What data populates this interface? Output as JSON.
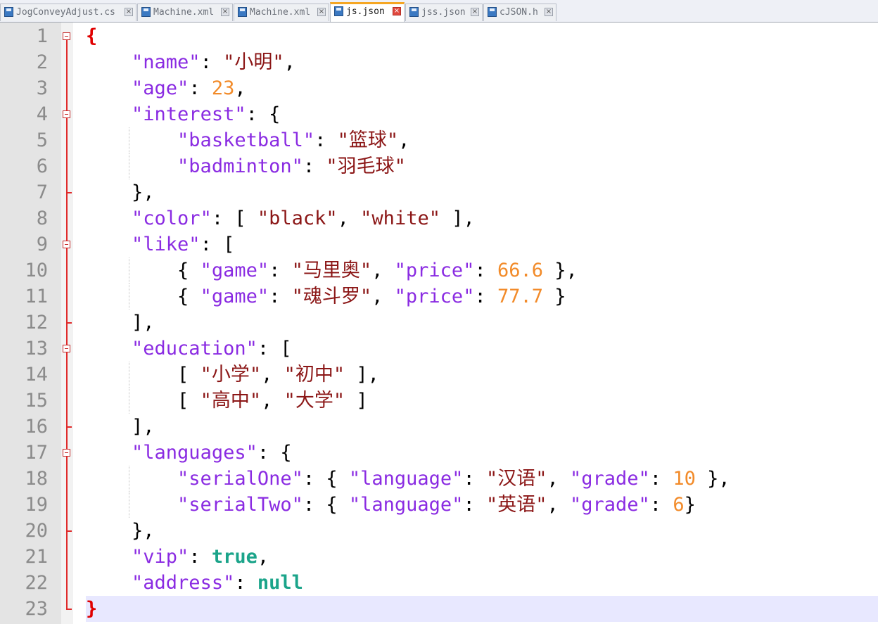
{
  "tabs": [
    {
      "label": "JogConveyAdjust.cs",
      "active": false
    },
    {
      "label": "Machine.xml",
      "active": false
    },
    {
      "label": "Machine.xml",
      "active": false
    },
    {
      "label": "js.json",
      "active": true
    },
    {
      "label": "jss.json",
      "active": false
    },
    {
      "label": "cJSON.h",
      "active": false
    }
  ],
  "editor": {
    "current_line": 23,
    "lines": [
      {
        "n": "1",
        "tokens": [
          {
            "t": "{",
            "c": "br"
          }
        ],
        "fold": "box"
      },
      {
        "n": "2",
        "tokens": [
          {
            "t": "    ",
            "c": "p"
          },
          {
            "t": "\"name\"",
            "c": "k"
          },
          {
            "t": ": ",
            "c": "p"
          },
          {
            "t": "\"小明\"",
            "c": "s"
          },
          {
            "t": ",",
            "c": "p"
          }
        ]
      },
      {
        "n": "3",
        "tokens": [
          {
            "t": "    ",
            "c": "p"
          },
          {
            "t": "\"age\"",
            "c": "k"
          },
          {
            "t": ": ",
            "c": "p"
          },
          {
            "t": "23",
            "c": "n"
          },
          {
            "t": ",",
            "c": "p"
          }
        ]
      },
      {
        "n": "4",
        "tokens": [
          {
            "t": "    ",
            "c": "p"
          },
          {
            "t": "\"interest\"",
            "c": "k"
          },
          {
            "t": ": {",
            "c": "p"
          }
        ],
        "fold": "box"
      },
      {
        "n": "5",
        "tokens": [
          {
            "t": "        ",
            "c": "p"
          },
          {
            "t": "\"basketball\"",
            "c": "k"
          },
          {
            "t": ": ",
            "c": "p"
          },
          {
            "t": "\"篮球\"",
            "c": "s"
          },
          {
            "t": ",",
            "c": "p"
          }
        ],
        "guide": true
      },
      {
        "n": "6",
        "tokens": [
          {
            "t": "        ",
            "c": "p"
          },
          {
            "t": "\"badminton\"",
            "c": "k"
          },
          {
            "t": ": ",
            "c": "p"
          },
          {
            "t": "\"羽毛球\"",
            "c": "s"
          }
        ],
        "guide": true
      },
      {
        "n": "7",
        "tokens": [
          {
            "t": "    },",
            "c": "p"
          }
        ],
        "fold": "tick"
      },
      {
        "n": "8",
        "tokens": [
          {
            "t": "    ",
            "c": "p"
          },
          {
            "t": "\"color\"",
            "c": "k"
          },
          {
            "t": ": [ ",
            "c": "p"
          },
          {
            "t": "\"black\"",
            "c": "s"
          },
          {
            "t": ", ",
            "c": "p"
          },
          {
            "t": "\"white\"",
            "c": "s"
          },
          {
            "t": " ],",
            "c": "p"
          }
        ]
      },
      {
        "n": "9",
        "tokens": [
          {
            "t": "    ",
            "c": "p"
          },
          {
            "t": "\"like\"",
            "c": "k"
          },
          {
            "t": ": [",
            "c": "p"
          }
        ],
        "fold": "box"
      },
      {
        "n": "10",
        "tokens": [
          {
            "t": "        { ",
            "c": "p"
          },
          {
            "t": "\"game\"",
            "c": "k"
          },
          {
            "t": ": ",
            "c": "p"
          },
          {
            "t": "\"马里奥\"",
            "c": "s"
          },
          {
            "t": ", ",
            "c": "p"
          },
          {
            "t": "\"price\"",
            "c": "k"
          },
          {
            "t": ": ",
            "c": "p"
          },
          {
            "t": "66.6",
            "c": "n"
          },
          {
            "t": " },",
            "c": "p"
          }
        ],
        "guide": true
      },
      {
        "n": "11",
        "tokens": [
          {
            "t": "        { ",
            "c": "p"
          },
          {
            "t": "\"game\"",
            "c": "k"
          },
          {
            "t": ": ",
            "c": "p"
          },
          {
            "t": "\"魂斗罗\"",
            "c": "s"
          },
          {
            "t": ", ",
            "c": "p"
          },
          {
            "t": "\"price\"",
            "c": "k"
          },
          {
            "t": ": ",
            "c": "p"
          },
          {
            "t": "77.7",
            "c": "n"
          },
          {
            "t": " }",
            "c": "p"
          }
        ],
        "guide": true
      },
      {
        "n": "12",
        "tokens": [
          {
            "t": "    ],",
            "c": "p"
          }
        ],
        "fold": "tick"
      },
      {
        "n": "13",
        "tokens": [
          {
            "t": "    ",
            "c": "p"
          },
          {
            "t": "\"education\"",
            "c": "k"
          },
          {
            "t": ": [",
            "c": "p"
          }
        ],
        "fold": "box"
      },
      {
        "n": "14",
        "tokens": [
          {
            "t": "        [ ",
            "c": "p"
          },
          {
            "t": "\"小学\"",
            "c": "s"
          },
          {
            "t": ", ",
            "c": "p"
          },
          {
            "t": "\"初中\"",
            "c": "s"
          },
          {
            "t": " ],",
            "c": "p"
          }
        ],
        "guide": true
      },
      {
        "n": "15",
        "tokens": [
          {
            "t": "        [ ",
            "c": "p"
          },
          {
            "t": "\"高中\"",
            "c": "s"
          },
          {
            "t": ", ",
            "c": "p"
          },
          {
            "t": "\"大学\"",
            "c": "s"
          },
          {
            "t": " ]",
            "c": "p"
          }
        ],
        "guide": true
      },
      {
        "n": "16",
        "tokens": [
          {
            "t": "    ],",
            "c": "p"
          }
        ],
        "fold": "tick"
      },
      {
        "n": "17",
        "tokens": [
          {
            "t": "    ",
            "c": "p"
          },
          {
            "t": "\"languages\"",
            "c": "k"
          },
          {
            "t": ": {",
            "c": "p"
          }
        ],
        "fold": "box"
      },
      {
        "n": "18",
        "tokens": [
          {
            "t": "        ",
            "c": "p"
          },
          {
            "t": "\"serialOne\"",
            "c": "k"
          },
          {
            "t": ": { ",
            "c": "p"
          },
          {
            "t": "\"language\"",
            "c": "k"
          },
          {
            "t": ": ",
            "c": "p"
          },
          {
            "t": "\"汉语\"",
            "c": "s"
          },
          {
            "t": ", ",
            "c": "p"
          },
          {
            "t": "\"grade\"",
            "c": "k"
          },
          {
            "t": ": ",
            "c": "p"
          },
          {
            "t": "10",
            "c": "n"
          },
          {
            "t": " },",
            "c": "p"
          }
        ],
        "guide": true
      },
      {
        "n": "19",
        "tokens": [
          {
            "t": "        ",
            "c": "p"
          },
          {
            "t": "\"serialTwo\"",
            "c": "k"
          },
          {
            "t": ": { ",
            "c": "p"
          },
          {
            "t": "\"language\"",
            "c": "k"
          },
          {
            "t": ": ",
            "c": "p"
          },
          {
            "t": "\"英语\"",
            "c": "s"
          },
          {
            "t": ", ",
            "c": "p"
          },
          {
            "t": "\"grade\"",
            "c": "k"
          },
          {
            "t": ": ",
            "c": "p"
          },
          {
            "t": "6",
            "c": "n"
          },
          {
            "t": "}",
            "c": "p"
          }
        ],
        "guide": true
      },
      {
        "n": "20",
        "tokens": [
          {
            "t": "    },",
            "c": "p"
          }
        ],
        "fold": "tick"
      },
      {
        "n": "21",
        "tokens": [
          {
            "t": "    ",
            "c": "p"
          },
          {
            "t": "\"vip\"",
            "c": "k"
          },
          {
            "t": ": ",
            "c": "p"
          },
          {
            "t": "true",
            "c": "b"
          },
          {
            "t": ",",
            "c": "p"
          }
        ]
      },
      {
        "n": "22",
        "tokens": [
          {
            "t": "    ",
            "c": "p"
          },
          {
            "t": "\"address\"",
            "c": "k"
          },
          {
            "t": ": ",
            "c": "p"
          },
          {
            "t": "null",
            "c": "b"
          }
        ]
      },
      {
        "n": "23",
        "tokens": [
          {
            "t": "}",
            "c": "br"
          }
        ],
        "fold": "tick"
      }
    ]
  },
  "colors": {
    "key": "#8a2be2",
    "string": "#8b1616",
    "number": "#f28b2a",
    "keyword": "#1ba48a",
    "brace": "#e00000",
    "current_line": "#e8e8ff",
    "active_tab_accent": "#f5a623"
  },
  "icons": {
    "tab_file": "floppy-disk-icon",
    "tab_close": "close-icon",
    "fold": "fold-minus-icon"
  }
}
